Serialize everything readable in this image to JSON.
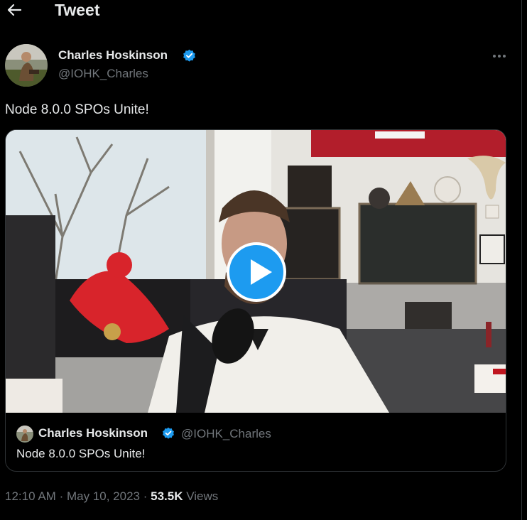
{
  "header": {
    "title": "Tweet",
    "back_icon": "arrow-left-icon"
  },
  "tweet": {
    "author": {
      "name": "Charles Hoskinson",
      "handle": "@IOHK_Charles",
      "verified": true
    },
    "text": "Node 8.0.0 SPOs Unite!",
    "timestamp": "12:10 AM",
    "date": "May 10, 2023",
    "separator": "·",
    "views_count": "53.5K",
    "views_label": "Views"
  },
  "quoted_tweet": {
    "author": {
      "name": "Charles Hoskinson",
      "handle": "@IOHK_Charles",
      "verified": true
    },
    "text": "Node 8.0.0 SPOs Unite!"
  },
  "colors": {
    "accent": "#1d9bf0",
    "background": "#000000",
    "text": "#e7e9ea",
    "muted": "#71767b",
    "border": "#2f3336"
  }
}
